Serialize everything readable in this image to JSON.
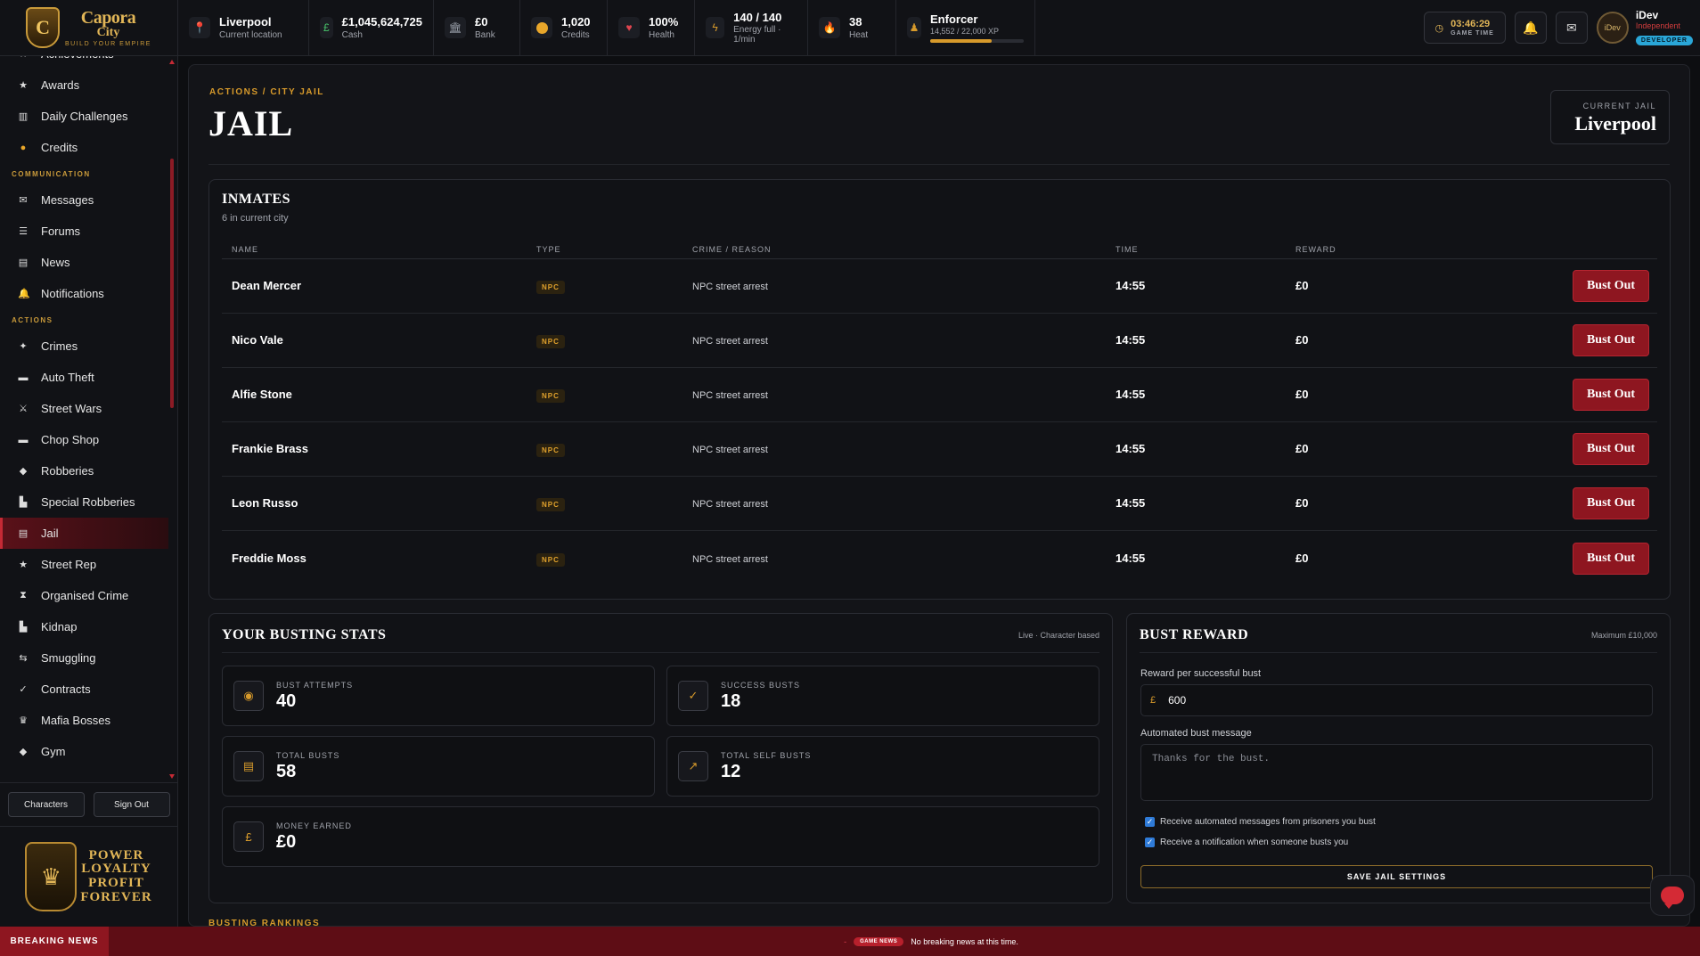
{
  "logo": {
    "name": "Capora",
    "name2": "City",
    "tagline": "BUILD YOUR EMPIRE"
  },
  "topbar": {
    "location": {
      "value": "Liverpool",
      "label": "Current location",
      "icon": "map-pin-icon"
    },
    "cash": {
      "value": "£1,045,624,725",
      "label": "Cash",
      "icon": "pound-icon"
    },
    "bank": {
      "value": "£0",
      "label": "Bank",
      "icon": "bank-icon"
    },
    "credits": {
      "value": "1,020",
      "label": "Credits",
      "icon": "coin-icon"
    },
    "health": {
      "value": "100%",
      "label": "Health",
      "icon": "heart-icon"
    },
    "energy": {
      "value": "140 / 140",
      "label": "Energy full · 1/min",
      "icon": "lightning-icon"
    },
    "heat": {
      "value": "38",
      "label": "Heat",
      "icon": "flame-icon"
    },
    "rank": {
      "value": "Enforcer",
      "label": "14,552 / 22,000 XP",
      "progress": 0.66,
      "icon": "rank-icon"
    },
    "game_time": {
      "value": "03:46:29",
      "label": "GAME TIME"
    },
    "user": {
      "name": "iDev",
      "faction": "Independent",
      "badge": "DEVELOPER",
      "avatar_text": "iDev"
    }
  },
  "sidebar": {
    "items_top": [
      {
        "label": "Achievements",
        "icon": "★"
      },
      {
        "label": "Awards",
        "icon": "★"
      },
      {
        "label": "Daily Challenges",
        "icon": "▥"
      },
      {
        "label": "Credits",
        "icon": "●"
      }
    ],
    "section_communication": "COMMUNICATION",
    "items_comm": [
      {
        "label": "Messages",
        "icon": "✉"
      },
      {
        "label": "Forums",
        "icon": "☰"
      },
      {
        "label": "News",
        "icon": "▤"
      },
      {
        "label": "Notifications",
        "icon": "🔔"
      }
    ],
    "section_actions": "ACTIONS",
    "items_actions": [
      {
        "label": "Crimes",
        "icon": "✦"
      },
      {
        "label": "Auto Theft",
        "icon": "▬"
      },
      {
        "label": "Street Wars",
        "icon": "⚔"
      },
      {
        "label": "Chop Shop",
        "icon": "▬"
      },
      {
        "label": "Robberies",
        "icon": "◆"
      },
      {
        "label": "Special Robberies",
        "icon": "▙"
      },
      {
        "label": "Jail",
        "icon": "▤"
      },
      {
        "label": "Street Rep",
        "icon": "★"
      },
      {
        "label": "Organised Crime",
        "icon": "⧗"
      },
      {
        "label": "Kidnap",
        "icon": "▙"
      },
      {
        "label": "Smuggling",
        "icon": "⇆"
      },
      {
        "label": "Contracts",
        "icon": "✓"
      },
      {
        "label": "Mafia Bosses",
        "icon": "♛"
      },
      {
        "label": "Gym",
        "icon": "◆"
      }
    ],
    "btn_characters": "Characters",
    "btn_signout": "Sign Out",
    "promo": [
      "POWER",
      "LOYALTY",
      "PROFIT",
      "FOREVER"
    ]
  },
  "page": {
    "breadcrumb": "ACTIONS / CITY JAIL",
    "title": "JAIL",
    "current_jail_label": "CURRENT JAIL",
    "current_jail": "Liverpool"
  },
  "inmates": {
    "title": "INMATES",
    "subtitle": "6 in current city",
    "columns": [
      "NAME",
      "TYPE",
      "CRIME / REASON",
      "TIME",
      "REWARD"
    ],
    "rows": [
      {
        "name": "Dean Mercer",
        "type": "NPC",
        "crime": "NPC street arrest",
        "time": "14:55",
        "reward": "£0",
        "action": "Bust Out"
      },
      {
        "name": "Nico Vale",
        "type": "NPC",
        "crime": "NPC street arrest",
        "time": "14:55",
        "reward": "£0",
        "action": "Bust Out"
      },
      {
        "name": "Alfie Stone",
        "type": "NPC",
        "crime": "NPC street arrest",
        "time": "14:55",
        "reward": "£0",
        "action": "Bust Out"
      },
      {
        "name": "Frankie Brass",
        "type": "NPC",
        "crime": "NPC street arrest",
        "time": "14:55",
        "reward": "£0",
        "action": "Bust Out"
      },
      {
        "name": "Leon Russo",
        "type": "NPC",
        "crime": "NPC street arrest",
        "time": "14:55",
        "reward": "£0",
        "action": "Bust Out"
      },
      {
        "name": "Freddie Moss",
        "type": "NPC",
        "crime": "NPC street arrest",
        "time": "14:55",
        "reward": "£0",
        "action": "Bust Out"
      }
    ]
  },
  "busting_stats": {
    "title": "YOUR BUSTING STATS",
    "note": "Live · Character based",
    "attempts": {
      "label": "BUST ATTEMPTS",
      "value": "40"
    },
    "success": {
      "label": "SUCCESS BUSTS",
      "value": "18"
    },
    "total": {
      "label": "TOTAL BUSTS",
      "value": "58"
    },
    "self": {
      "label": "TOTAL SELF BUSTS",
      "value": "12"
    },
    "money": {
      "label": "MONEY EARNED",
      "value": "£0"
    }
  },
  "bust_reward": {
    "title": "BUST REWARD",
    "note": "Maximum £10,000",
    "reward_label": "Reward per successful bust",
    "currency": "£",
    "reward_value": "600",
    "message_label": "Automated bust message",
    "message_placeholder": "Thanks for the bust.",
    "check1": "Receive automated messages from prisoners you bust",
    "check2": "Receive a notification when someone busts you",
    "save": "SAVE JAIL SETTINGS"
  },
  "rankings_title": "BUSTING RANKINGS",
  "news": {
    "label": "BREAKING NEWS",
    "pill": "GAME NEWS",
    "text": "No breaking news at this time."
  }
}
